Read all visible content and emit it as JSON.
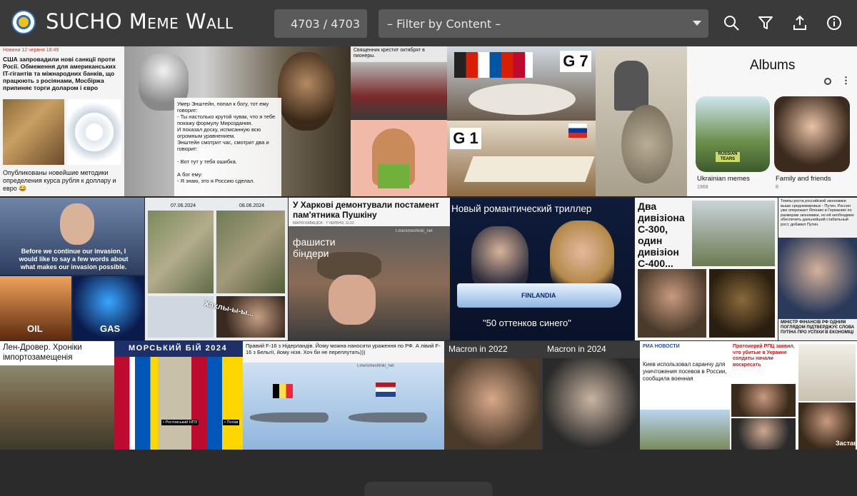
{
  "app": {
    "title": "SUCHO Meme Wall",
    "counter": "4703 / 4703",
    "filter_placeholder": "– Filter by Content –"
  },
  "toolbar": {
    "icons": [
      "search-icon",
      "filter-icon",
      "upload-icon",
      "info-icon"
    ]
  },
  "tiles": {
    "t1": {
      "header": "Новини  12 червня 18:49",
      "title": "США запровадили нові санкції проти Росії. Обмеження для американських IT-гігантів та міжнародних банків, що працюють з росіянами, Мосбіржа припиняє торги доларом і євро",
      "caption": "Опубликованы новейшие методики определения курса рубля к доллару и евро 😂"
    },
    "t2": {
      "text": "Умер Энштейн, попал к богу, тот ему говорит:\n- Ты настолько крутой чувак, что я тебе покажу формулу Мироздания.\nИ показал доску, исписанную всю огромным уравнением.\nЭнштейн смотрит час, смотрит два и говорит:\n\n- Вот тут у тебя ошибка.\n\nА бог ему:\n- Я знаю, это я Россию сделал."
    },
    "t3": {
      "caption": "Священник крестит октябрят в пионеры."
    },
    "t4": {
      "label_top": "G 7",
      "label_bottom": "G 1"
    },
    "t6": {
      "title": "Albums",
      "album1": "Ukrainian memes",
      "album1_count": "1968",
      "album2": "Family and friends",
      "album2_count": "8",
      "jar_label": "RUSSIAN TEARS"
    },
    "t7": {
      "caption": "Before we continue our invasion, I would like to say a few words about what makes our invasion possible.",
      "oil": "OIL",
      "gas": "GAS"
    },
    "t8": {
      "date1": "07.06.2024",
      "date2": "08.06.2024",
      "text": "Хахлы-ы-ы..."
    },
    "t9": {
      "title": "У Харкові демонтували постамент пам'ятника Пушкіну",
      "subtitle": "МАРІЯ КАВАЦЮК · 7 ЧЕРВНЯ, 11:02",
      "overlay": "фашисти біндери",
      "watermark": "t.me/smeshinki_net"
    },
    "t10": {
      "title": "Новый романтический триллер",
      "bottle": "FINLANDIA",
      "caption": "\"50 оттенков синего\""
    },
    "t11": {
      "text": "Два дивізіона С-300, один дивізіон С-400..."
    },
    "t12": {
      "text": "Темпы роста российской экономики выше среднемировых - Путин. Россия уже опережает Японию и Германию по размерам экономики, но ей необходимо обеспечить дальнейший стабильный рост, добавил Путин.",
      "caption": "МІНІСТР ФІНАНСІВ РФ ОДНИМ ПОГЛЯДОМ ПІДТВЕРДЖУЄ СЛОВА ПУТІНА ПРО УСПІХИ В ЕКОНОМІЦІ"
    },
    "t13": {
      "title": "Лен-Дровер. Хроніки імпортозамещенія"
    },
    "t14": {
      "title": "МОРСЬКИЙ БІЙ 2024",
      "label1": "• Ростовський НПЗ",
      "label2": "• Попав"
    },
    "t15": {
      "text": "Правий F-16 з Нідерландів. Йому можна наносити ураження по РФ. А лівий F-16 з Бельгії, йому нізя. Хоч би не переплутать)))",
      "watermark": "t.me/smeshinki_net"
    },
    "t16": {
      "left": "Macron in 2022",
      "right": "Macron in 2024"
    },
    "t17": {
      "brand": "РИА НОВОСТИ",
      "headline": "Киев использовал саранчу для уничтожения посевов в России, сообщила военная"
    },
    "t18": {
      "headline": "Протоиерей РПЦ заявил, что убитые в Украине солдаты начали воскресать",
      "footer": "Застав"
    }
  },
  "colors": {
    "topbar": "#3a3a3a",
    "background": "#2b2b2b",
    "field": "#5a5a5a",
    "text": "#ffffff",
    "accent": "#2f6fb5"
  }
}
